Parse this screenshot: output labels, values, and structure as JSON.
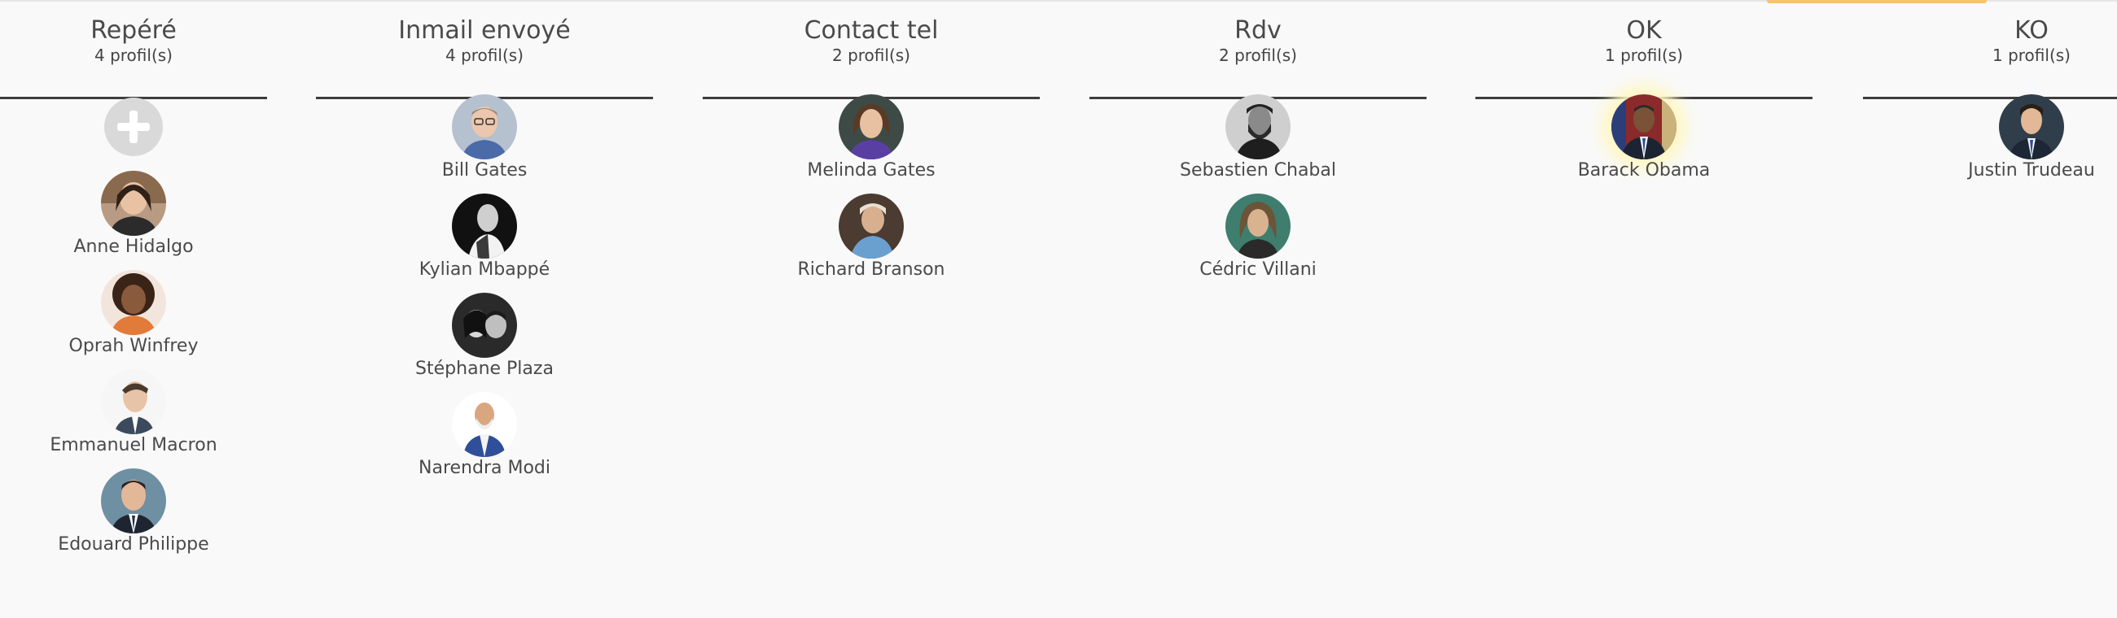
{
  "columns": [
    {
      "title": "Repéré",
      "count": "4 profil(s)",
      "add_button_icon": "plus-icon",
      "profiles": [
        {
          "name": "Anne Hidalgo"
        },
        {
          "name": "Oprah Winfrey"
        },
        {
          "name": "Emmanuel Macron"
        },
        {
          "name": "Edouard Philippe"
        }
      ]
    },
    {
      "title": "Inmail envoyé",
      "count": "4 profil(s)",
      "profiles": [
        {
          "name": "Bill Gates"
        },
        {
          "name": "Kylian Mbappé"
        },
        {
          "name": "Stéphane Plaza"
        },
        {
          "name": "Narendra Modi"
        }
      ]
    },
    {
      "title": "Contact tel",
      "count": "2 profil(s)",
      "profiles": [
        {
          "name": "Melinda Gates"
        },
        {
          "name": "Richard Branson"
        }
      ]
    },
    {
      "title": "Rdv",
      "count": "2 profil(s)",
      "profiles": [
        {
          "name": "Sebastien Chabal"
        },
        {
          "name": "Cédric Villani"
        }
      ]
    },
    {
      "title": "OK",
      "count": "1 profil(s)",
      "profiles": [
        {
          "name": "Barack Obama"
        }
      ]
    },
    {
      "title": "KO",
      "count": "1 profil(s)",
      "profiles": [
        {
          "name": "Justin Trudeau"
        }
      ]
    }
  ]
}
